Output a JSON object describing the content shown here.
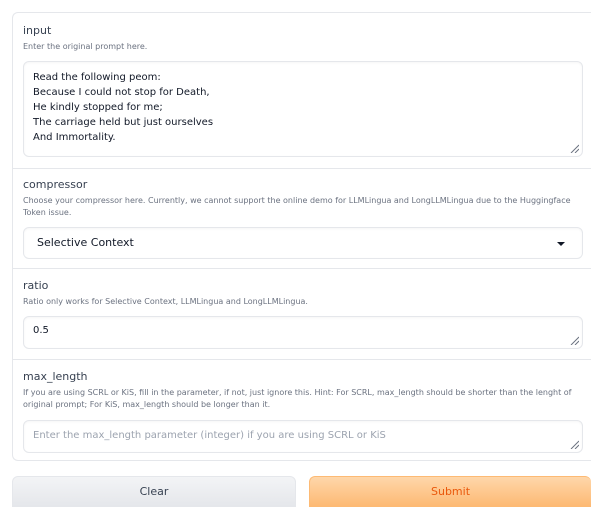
{
  "input": {
    "label": "input",
    "info": "Enter the original prompt here.",
    "value": "Read the following peom:\nBecause I could not stop for Death,\nHe kindly stopped for me;\nThe carriage held but just ourselves\nAnd Immortality."
  },
  "compressor": {
    "label": "compressor",
    "info": "Choose your compressor here. Currently, we cannot support the online demo for LLMLingua and LongLLMLingua due to the Huggingface Token issue.",
    "selected": "Selective Context"
  },
  "ratio": {
    "label": "ratio",
    "info": "Ratio only works for Selective Context, LLMLingua and LongLLMLingua.",
    "value": "0.5"
  },
  "max_length": {
    "label": "max_length",
    "info": "If you are using SCRL or KiS, fill in the parameter, if not, just ignore this. Hint: For SCRL, max_length should be shorter than the lenght of original prompt; For KiS, max_length should be longer than it.",
    "placeholder": "Enter the max_length parameter (integer) if you are using SCRL or KiS"
  },
  "buttons": {
    "clear": "Clear",
    "submit": "Submit"
  }
}
